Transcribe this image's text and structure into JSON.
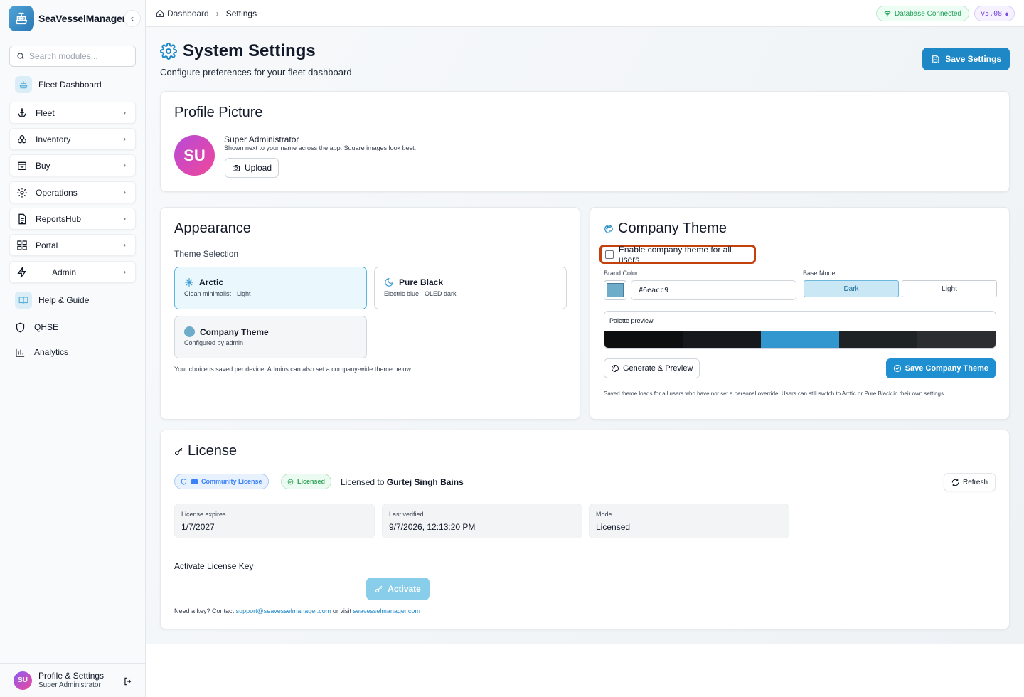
{
  "app": {
    "name": "SeaVesselManager",
    "logo_icon": "ship-icon"
  },
  "sidebar": {
    "search_placeholder": "Search modules...",
    "items": [
      {
        "label": "Fleet Dashboard",
        "icon": "ship-icon",
        "style": "plain"
      },
      {
        "label": "Fleet",
        "icon": "anchor-icon",
        "style": "card"
      },
      {
        "label": "Inventory",
        "icon": "boxes-icon",
        "style": "card"
      },
      {
        "label": "Buy",
        "icon": "shopping-bag-icon",
        "style": "card"
      },
      {
        "label": "Operations",
        "icon": "gear-icon",
        "style": "card"
      },
      {
        "label": "ReportsHub",
        "icon": "document-icon",
        "style": "card"
      },
      {
        "label": "Portal",
        "icon": "grid-icon",
        "style": "card"
      },
      {
        "label": "Admin",
        "icon": "bolt-icon",
        "style": "card"
      },
      {
        "label": "Help & Guide",
        "icon": "book-icon",
        "style": "plain"
      },
      {
        "label": "QHSE",
        "icon": "shield-icon",
        "style": "simple"
      },
      {
        "label": "Analytics",
        "icon": "bar-chart-icon",
        "style": "simple"
      }
    ],
    "footer": {
      "avatar_initials": "SU",
      "title": "Profile & Settings",
      "subtitle": "Super Administrator"
    }
  },
  "topbar": {
    "breadcrumb": [
      "Dashboard",
      "Settings"
    ],
    "db_status": "Database Connected",
    "version": "v5.08"
  },
  "page": {
    "title": "System Settings",
    "subtitle": "Configure preferences for your fleet dashboard",
    "save_label": "Save Settings"
  },
  "profile": {
    "title": "Profile Picture",
    "initials": "SU",
    "name": "Super Administrator",
    "hint": "Shown next to your name across the app. Square images look best.",
    "upload_label": "Upload"
  },
  "appearance": {
    "title": "Appearance",
    "section_label": "Theme Selection",
    "options": [
      {
        "title": "Arctic",
        "subtitle": "Clean minimalist · Light",
        "selected": true
      },
      {
        "title": "Pure Black",
        "subtitle": "Electric blue · OLED dark",
        "selected": false
      },
      {
        "title": "Company Theme",
        "subtitle": "Configured by admin",
        "selected": false
      }
    ],
    "note": "Your choice is saved per device. Admins can also set a company-wide theme below."
  },
  "company_theme": {
    "title": "Company Theme",
    "enable_label": "Enable company theme for all users",
    "enabled": false,
    "brand_color_label": "Brand Color",
    "brand_color": "#6eacc9",
    "base_mode_label": "Base Mode",
    "modes": [
      "Dark",
      "Light"
    ],
    "selected_mode": "Dark",
    "palette_label": "Palette preview",
    "palette": [
      "#0d0e10",
      "#16181b",
      "#3397cf",
      "#202326",
      "#2b2d30"
    ],
    "generate_label": "Generate & Preview",
    "save_label": "Save Company Theme",
    "note": "Saved theme loads for all users who have not set a personal override. Users can still switch to Arctic or Pure Black in their own settings."
  },
  "license": {
    "title": "License",
    "type_badge": "Community License",
    "status_badge": "Licensed",
    "licensed_to_prefix": "Licensed to",
    "licensed_to": "Gurtej Singh Bains",
    "refresh_label": "Refresh",
    "stats": [
      {
        "label": "License expires",
        "value": "1/7/2027"
      },
      {
        "label": "Last verified",
        "value": "9/7/2026, 12:13:20 PM"
      },
      {
        "label": "Mode",
        "value": "Licensed"
      }
    ],
    "activate_title": "Activate License Key",
    "activate_label": "Activate",
    "need_key_prefix": "Need a key? Contact",
    "support_email": "support@seavesselmanager.com",
    "or_visit": "or visit",
    "website": "seavesselmanager.com"
  },
  "colors": {
    "accent": "#1e88c6",
    "highlight": "#c2410c"
  }
}
